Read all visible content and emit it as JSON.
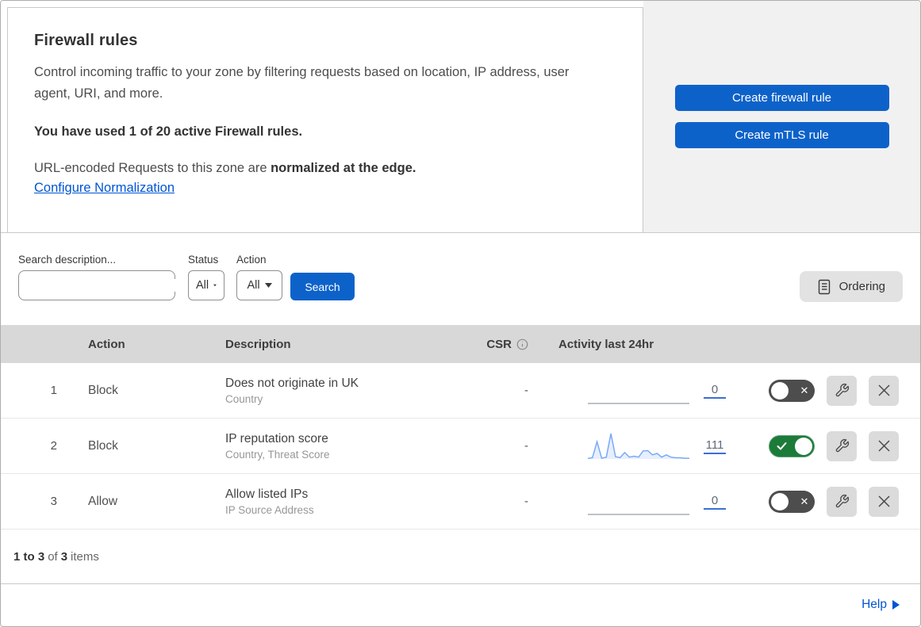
{
  "header": {
    "title": "Firewall rules",
    "description": "Control incoming traffic to your zone by filtering requests based on location, IP address, user agent, URI, and more.",
    "usage": "You have used 1 of 20 active Firewall rules.",
    "normalization_prefix": "URL-encoded Requests to this zone are ",
    "normalization_bold": "normalized at the edge.",
    "configure_link": "Configure Normalization",
    "create_firewall_button": "Create firewall rule",
    "create_mtls_button": "Create mTLS rule"
  },
  "filters": {
    "search_label": "Search description...",
    "search_value": "",
    "status_label": "Status",
    "status_value": "All",
    "action_label": "Action",
    "action_value": "All",
    "search_button": "Search",
    "ordering_button": "Ordering"
  },
  "table": {
    "columns": {
      "action": "Action",
      "description": "Description",
      "csr": "CSR",
      "activity": "Activity last 24hr"
    },
    "rows": [
      {
        "number": "1",
        "action": "Block",
        "description": "Does not originate in UK",
        "criteria": "Country",
        "csr": "-",
        "activity_count": "0",
        "enabled": false,
        "toggle_mark": "✕"
      },
      {
        "number": "2",
        "action": "Block",
        "description": "IP reputation score",
        "criteria": "Country, Threat Score",
        "csr": "-",
        "activity_count": "111",
        "enabled": true,
        "toggle_mark": "✓"
      },
      {
        "number": "3",
        "action": "Allow",
        "description": "Allow listed IPs",
        "criteria": "IP Source Address",
        "csr": "-",
        "activity_count": "0",
        "enabled": false,
        "toggle_mark": "✕"
      }
    ]
  },
  "footer": {
    "range": "1 to 3",
    "of_word": "of",
    "total": "3",
    "items_word": "items",
    "help": "Help"
  },
  "colors": {
    "primary_blue": "#0d62c9",
    "toggle_on_green": "#1d7b39",
    "toggle_off_gray": "#4d4d4d",
    "link_blue": "#0055d4",
    "sparkline_blue": "#7aa9f7",
    "sparkline_flat_gray": "#a7aeb8",
    "table_header_gray": "#d8d8d8",
    "panel_gray": "#f2f1f1"
  },
  "chart_data": {
    "type": "line",
    "title": "Activity last 24hr sparklines",
    "x": [
      0,
      1,
      2,
      3,
      4,
      5,
      6,
      7,
      8,
      9,
      10,
      11,
      12,
      13,
      14,
      15,
      16,
      17,
      18,
      19,
      20,
      21,
      22
    ],
    "series": [
      {
        "name": "rule-1-requests",
        "total": 0,
        "values": [
          0,
          0,
          0,
          0,
          0,
          0,
          0,
          0,
          0,
          0,
          0,
          0,
          0,
          0,
          0,
          0,
          0,
          0,
          0,
          0,
          0,
          0,
          0
        ]
      },
      {
        "name": "rule-2-requests",
        "total": 111,
        "values": [
          2,
          5,
          75,
          3,
          8,
          110,
          10,
          6,
          28,
          8,
          12,
          8,
          35,
          36,
          18,
          24,
          8,
          18,
          8,
          5,
          5,
          3,
          3
        ]
      },
      {
        "name": "rule-3-requests",
        "total": 0,
        "values": [
          0,
          0,
          0,
          0,
          0,
          0,
          0,
          0,
          0,
          0,
          0,
          0,
          0,
          0,
          0,
          0,
          0,
          0,
          0,
          0,
          0,
          0,
          0
        ]
      }
    ],
    "ylim": [
      0,
      110
    ],
    "grid": false,
    "legend": false
  }
}
